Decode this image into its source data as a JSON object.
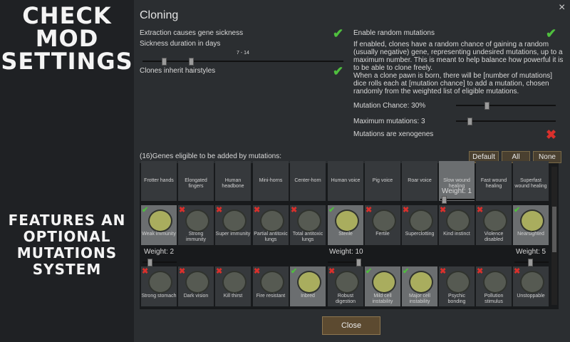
{
  "promo": {
    "top_lines": [
      "CHECK",
      "MOD",
      "SETTINGS"
    ],
    "bottom_lines": [
      "FEATURES AN",
      "OPTIONAL",
      "MUTATIONS",
      "SYSTEM"
    ]
  },
  "dialog": {
    "close_icon": "×",
    "title": "Cloning",
    "left": {
      "extraction_label": "Extraction causes gene sickness",
      "sickness_label": "Sickness duration in days",
      "sickness_range": "7 - 14",
      "hairstyles_label": "Clones inherit hairstyles"
    },
    "right": {
      "random_mutations_label": "Enable random mutations",
      "para1": "If enabled, clones have a random chance of gaining a random (usually negative) gene, representing undesired mutations, up to a maximum number. This is meant to help balance how powerful it is to be able to clone freely.",
      "para2": "When a clone pawn is born, there will be [number of mutations] dice rolls each at [mutation chance] to add a mutation, chosen randomly from the weighted list of eligible mutations.",
      "chance_label": "Mutation Chance: 30%",
      "max_label": "Maximum mutations: 3",
      "xenogenes_label": "Mutations are xenogenes"
    },
    "genes_header": "(16)Genes eligible to be added by mutations:",
    "buttons": {
      "default": "Default",
      "all": "All",
      "none": "None"
    },
    "row0": [
      "Frotter hands",
      "Elongated fingers",
      "Human headbone",
      "Mini-horns",
      "Center-horn",
      "Human voice",
      "Pig voice",
      "Roar voice",
      "Slow wound healing",
      "Fast wound healing",
      "Superfast wound healing"
    ],
    "row1": [
      "Weak immunity",
      "Strong immunity",
      "Super immunity",
      "Partial antitoxic lungs",
      "Total antitoxic lungs",
      "Sterile",
      "Fertile",
      "Superclotting",
      "Kind instinct",
      "Violence disabled",
      "Nearsighted"
    ],
    "row2": [
      "Strong stomach",
      "Dark vision",
      "Kill thirst",
      "Fire resistant",
      "Inbred",
      "Robust digestion",
      "Mild cell instability",
      "Major cell instability",
      "Psychic bonding",
      "Pollution stimulus",
      "Unstoppable"
    ],
    "weights": {
      "w1": "Weight: 1",
      "w2": "Weight: 2",
      "w10": "Weight: 10",
      "w5": "Weight: 5"
    },
    "close_button": "Close"
  },
  "colors": {
    "check": "#4fbf3e",
    "cross": "#d9302c",
    "accent_button": "#5c4a30"
  }
}
